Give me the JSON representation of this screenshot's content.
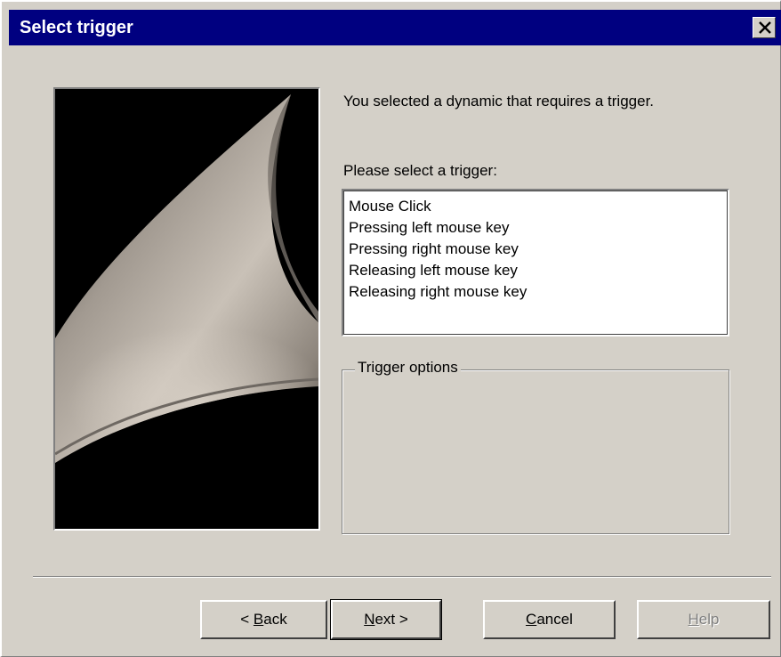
{
  "window": {
    "title": "Select trigger",
    "close_label": "×"
  },
  "content": {
    "intro_text": "You selected a dynamic that requires a trigger.",
    "select_label": "Please select a trigger:",
    "triggers": [
      "Mouse Click",
      "Pressing left mouse key",
      "Pressing right mouse key",
      "Releasing left mouse key",
      "Releasing right mouse key"
    ],
    "options_group_label": "Trigger options"
  },
  "buttons": {
    "back": {
      "prefix": "< ",
      "mnemonic": "B",
      "rest": "ack"
    },
    "next": {
      "prefix": "",
      "mnemonic": "N",
      "rest": "ext >"
    },
    "cancel": {
      "prefix": "",
      "mnemonic": "C",
      "rest": "ancel"
    },
    "help": {
      "prefix": "",
      "mnemonic": "H",
      "rest": "elp",
      "disabled": true
    }
  },
  "colors": {
    "titlebar": "#000080",
    "dialog_face": "#d4d0c8"
  }
}
